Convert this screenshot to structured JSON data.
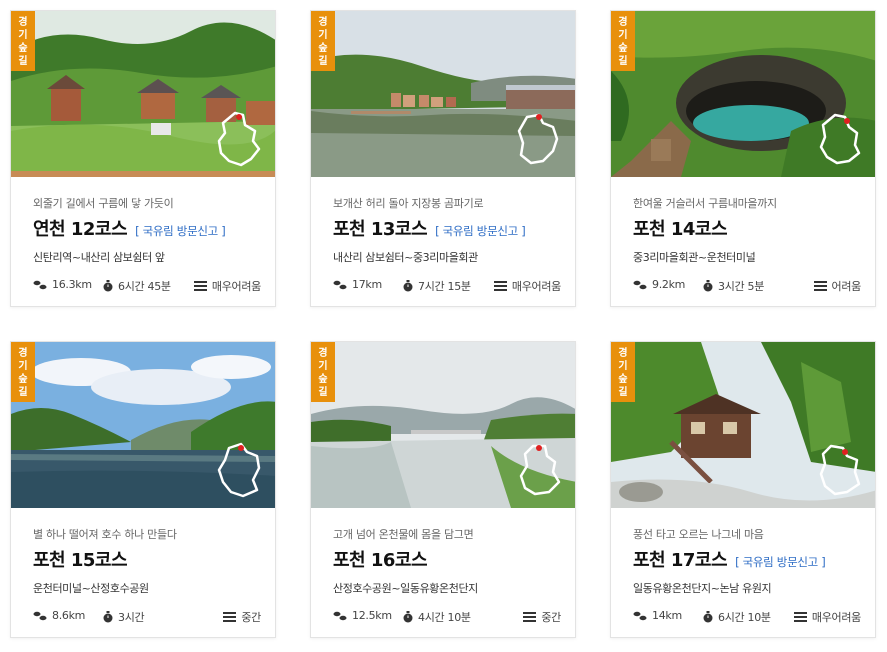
{
  "badge_label": [
    "경",
    "기",
    "숲",
    "길"
  ],
  "cards": [
    {
      "subtitle": "외줄기 길에서 구름에 닿 가듯이",
      "title": "연천 12코스",
      "notice": "[ 국유림 방문신고 ]",
      "route": "신탄리역~내산리 삼보쉼터 앞",
      "distance": "16.3km",
      "time": "6시간 45분",
      "difficulty": "매우어려움",
      "photo_scene": "village-forest"
    },
    {
      "subtitle": "보개산 허리 돌아 지장봉 곰파기로",
      "title": "포천 13코스",
      "notice": "[ 국유림 방문신고 ]",
      "route": "내산리 삼보쉼터~중3리마을회관",
      "distance": "17km",
      "time": "7시간 15분",
      "difficulty": "매우어려움",
      "photo_scene": "lake-cabins"
    },
    {
      "subtitle": "한여울 거슬러서 구름내마을까지",
      "title": "포천 14코스",
      "notice": "",
      "route": "중3리마을회관~운천터미널",
      "distance": "9.2km",
      "time": "3시간 5분",
      "difficulty": "어려움",
      "photo_scene": "cave-pool"
    },
    {
      "subtitle": "별 하나 떨어져 호수 하나 만들다",
      "title": "포천 15코스",
      "notice": "",
      "route": "운천터미널~산정호수공원",
      "distance": "8.6km",
      "time": "3시간",
      "difficulty": "중간",
      "photo_scene": "mountain-lake"
    },
    {
      "subtitle": "고개 넘어 온천물에 몸을 담그면",
      "title": "포천 16코스",
      "notice": "",
      "route": "산정호수공원~일동유황온천단지",
      "distance": "12.5km",
      "time": "4시간 10분",
      "difficulty": "중간",
      "photo_scene": "river"
    },
    {
      "subtitle": "풍선 타고 오르는 나그네 마음",
      "title": "포천 17코스",
      "notice": "[ 국유림 방문신고 ]",
      "route": "일동유황온천단지~논남 유원지",
      "distance": "14km",
      "time": "6시간 10분",
      "difficulty": "매우어려움",
      "photo_scene": "log-cabin"
    }
  ],
  "colors": {
    "ribbon": "#e8900c",
    "notice": "#2f6dc5",
    "map_dot": "#e02020"
  }
}
